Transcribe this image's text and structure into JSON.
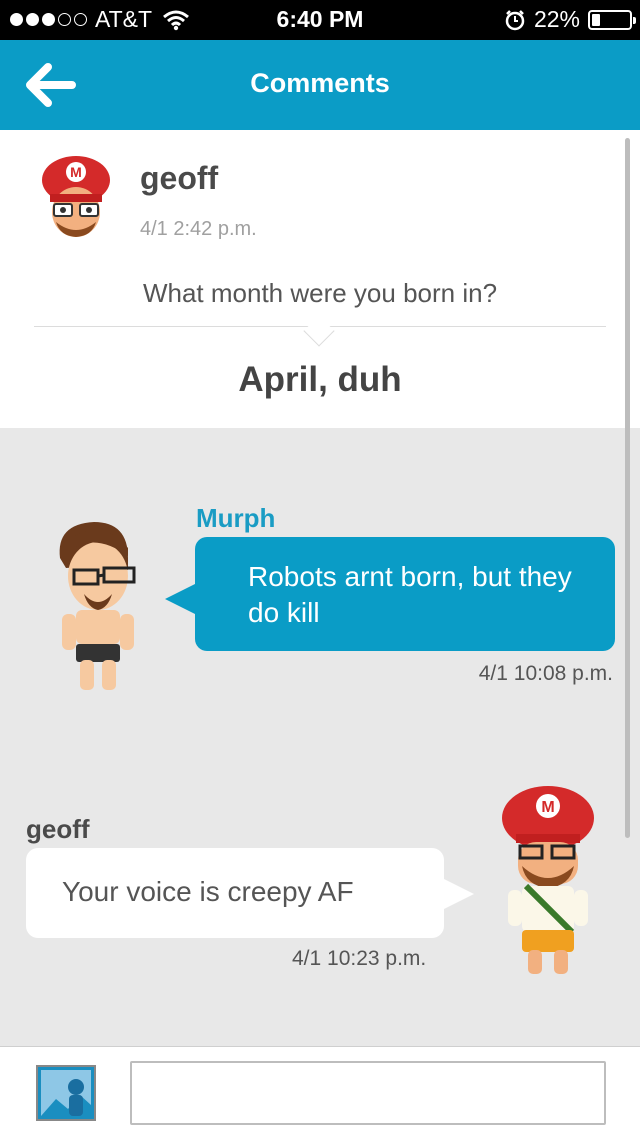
{
  "status_bar": {
    "signal_dots_filled": 3,
    "signal_dots_total": 5,
    "carrier": "AT&T",
    "time": "6:40 PM",
    "battery_percent": "22%",
    "battery_level": 0.22,
    "icons": [
      "wifi-icon",
      "alarm-icon",
      "battery-icon"
    ]
  },
  "header": {
    "title": "Comments",
    "back_icon": "arrow-left-icon"
  },
  "post": {
    "author": "geoff",
    "timestamp": "4/1 2:42 p.m.",
    "question": "What month were you born in?",
    "answer": "April, duh"
  },
  "comments": [
    {
      "author": "Murph",
      "text": "Robots arnt born, but they do kill",
      "timestamp": "4/1 10:08 p.m.",
      "bubble_color": "#0a9cc6"
    },
    {
      "author": "geoff",
      "text": "Your voice is creepy AF",
      "timestamp": "4/1 10:23 p.m.",
      "bubble_color": "#ffffff"
    }
  ],
  "composer": {
    "photo_icon": "image-icon",
    "input_value": "",
    "input_placeholder": ""
  },
  "colors": {
    "accent": "#0b9cc6",
    "background": "#e8e8e8"
  }
}
